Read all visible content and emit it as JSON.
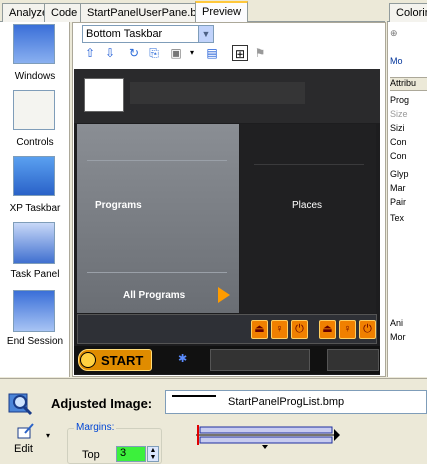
{
  "tabs": [
    {
      "label": "Analyze",
      "active": false
    },
    {
      "label": "Code",
      "active": false
    },
    {
      "label": "StartPanelUserPane.bmp",
      "active": false
    },
    {
      "label": "Preview",
      "active": true
    }
  ],
  "right_tab": {
    "label": "Coloring"
  },
  "palette": {
    "items": [
      {
        "label": "Windows"
      },
      {
        "label": "Controls"
      },
      {
        "label": "XP Taskbar"
      },
      {
        "label": "Task Panel"
      },
      {
        "label": "End Session"
      }
    ]
  },
  "preview": {
    "taskbar_select": "Bottom Taskbar",
    "start_panel": {
      "programs": "Programs",
      "places": "Places",
      "all_programs": "All Programs",
      "start": "START"
    }
  },
  "attributes": {
    "header": "Attribu",
    "items": [
      "Mo",
      "Prog",
      "Size",
      "Sizi",
      "Con",
      "Con",
      "Glyp",
      "Mar",
      "Pair",
      "Tex",
      "Ani",
      "Mor"
    ]
  },
  "bottom": {
    "adjusted_label": "Adjusted Image:",
    "adjusted_file": "StartPanelProgList.bmp",
    "edit_label": "Edit",
    "margins_label": "Margins:",
    "top_label": "Top",
    "top_value": "3"
  },
  "colors": {
    "tab_accent": "#ffc83c",
    "start_orange": "#e08c00",
    "margin_field": "#3cf03c"
  }
}
